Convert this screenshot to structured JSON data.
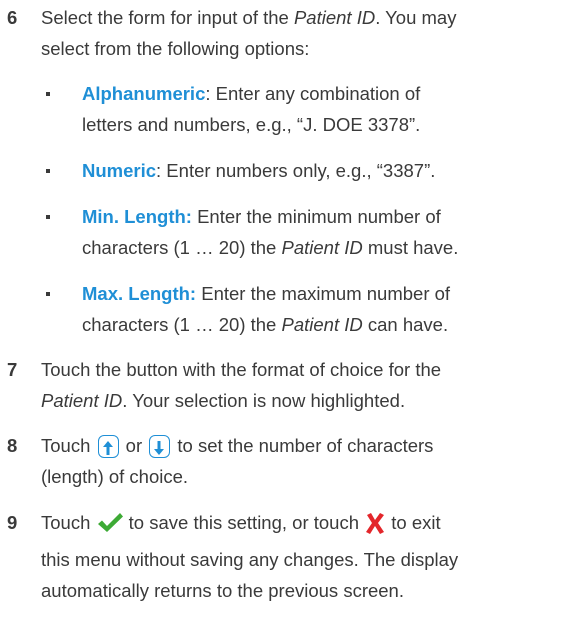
{
  "steps": [
    {
      "number": "6",
      "line1_a": "Select the form for input of the ",
      "line1_em": "Patient ID",
      "line1_b": ". You may",
      "line2": "select from the following options:"
    },
    {
      "number": "7",
      "line1": "Touch the button with the format of choice for the",
      "line2_em": "Patient ID",
      "line2_b": ". Your selection is now highlighted."
    },
    {
      "number": "8",
      "line1_a": "Touch ",
      "line1_or": " or ",
      "line1_b": " to set the number of characters",
      "line2": "(length) of choice."
    },
    {
      "number": "9",
      "line1_a": "Touch ",
      "line1_b": " to save this setting, or touch ",
      "line1_c": " to exit",
      "line2": "this menu without saving any changes. The display",
      "line3": "automatically returns to the previous screen."
    }
  ],
  "options": [
    {
      "term": "Alphanumeric",
      "line1_rest": ": Enter any combination of",
      "line2": "letters and numbers, e.g., “J. DOE 3378”."
    },
    {
      "term": "Numeric",
      "line1_rest": ": Enter numbers only, e.g., “3387”."
    },
    {
      "term": "Min. Length:",
      "line1_rest": " Enter the minimum number of",
      "line2_a": "characters (1 … 20) the ",
      "line2_em": "Patient ID",
      "line2_b": " must have."
    },
    {
      "term": "Max. Length:",
      "line1_rest": " Enter the maximum number of",
      "line2_a": "characters (1 … 20) the ",
      "line2_em": "Patient ID",
      "line2_b": " can have."
    }
  ],
  "icons": {
    "up": "arrow-up-icon",
    "down": "arrow-down-icon",
    "save": "checkmark-icon",
    "exit": "cross-icon"
  },
  "colors": {
    "accent": "#1f8fd6",
    "text": "#3a3a3a",
    "check": "#3daa35",
    "cross": "#e3262b"
  }
}
